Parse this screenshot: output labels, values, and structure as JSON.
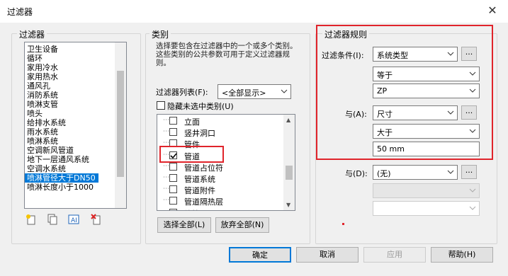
{
  "window": {
    "title": "过滤器",
    "close": "✕"
  },
  "filters": {
    "group_label": "过滤器",
    "items": [
      "卫生设备",
      "循环",
      "家用冷水",
      "家用热水",
      "通风孔",
      "消防系统",
      "喷淋支管",
      "喷头",
      "给排水系统",
      "雨水系统",
      "喷淋系统",
      "空调新风管道",
      "地下一层通风系统",
      "空调水系统",
      "喷淋管径大于DN50",
      "喷淋长度小于1000"
    ],
    "selected_index": 14,
    "icons": [
      "new-filter-icon",
      "duplicate-filter-icon",
      "rename-filter-icon",
      "delete-filter-icon"
    ]
  },
  "categories": {
    "group_label": "类别",
    "description": "选择要包含在过滤器中的一个或多个类别。这些类别的公共参数可用于定义过滤器规则。",
    "list_label": "过滤器列表(F):",
    "list_value": "<全部显示>",
    "hide_unchecked_label": "隐藏未选中类别(U)",
    "items": [
      {
        "label": "立面",
        "checked": false
      },
      {
        "label": "竖井洞口",
        "checked": false
      },
      {
        "label": "管件",
        "checked": false
      },
      {
        "label": "管道",
        "checked": true
      },
      {
        "label": "管道占位符",
        "checked": false
      },
      {
        "label": "管道系统",
        "checked": false
      },
      {
        "label": "管道附件",
        "checked": false
      },
      {
        "label": "管道隔热层",
        "checked": false
      },
      {
        "label": "线管",
        "checked": false
      }
    ],
    "select_all": "选择全部(L)",
    "clear_all": "放弃全部(N)"
  },
  "rules": {
    "group_label": "过滤器规则",
    "condition_label": "过滤条件(I):",
    "condition_param": "系统类型",
    "condition_op": "等于",
    "condition_value": "ZP",
    "and_a_label": "与(A):",
    "and_a_param": "尺寸",
    "and_a_op": "大于",
    "and_a_value": "50 mm",
    "and_d_label": "与(D):",
    "and_d_param": "(无)",
    "and_d_op": "",
    "and_d_value": "",
    "ellipsis": "..."
  },
  "buttons": {
    "ok": "确定",
    "cancel": "取消",
    "apply": "应用",
    "help": "帮助(H)"
  },
  "colors": {
    "highlight": "#e0242b",
    "selection": "#0078d7"
  }
}
